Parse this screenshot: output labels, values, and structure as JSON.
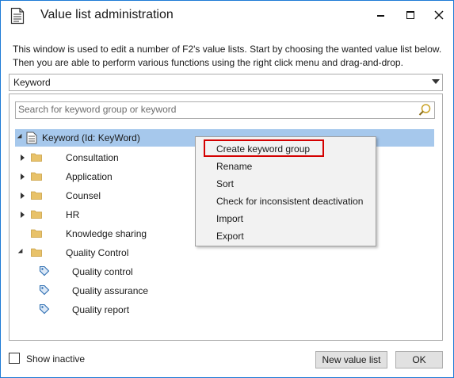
{
  "window": {
    "title": "Value list administration",
    "icons": {
      "app": "document-list-icon",
      "minimize": "minimize-icon",
      "maximize": "maximize-icon",
      "close": "close-icon"
    }
  },
  "description": {
    "line1": "This window is used to edit a number of F2's value lists. Start by choosing the wanted value list below.",
    "line2": "Then you are able to perform various functions using the right click menu and drag-and-drop."
  },
  "value_list_select": {
    "selected": "Keyword"
  },
  "search": {
    "placeholder": "Search for keyword group or keyword",
    "value": ""
  },
  "tree": {
    "root": {
      "label": "Keyword (Id: KeyWord)",
      "icon": "keyword-list-icon",
      "expanded": true,
      "selected": true
    },
    "groups": [
      {
        "label": "Consultation",
        "expander": "collapsed"
      },
      {
        "label": "Application",
        "expander": "collapsed"
      },
      {
        "label": "Counsel",
        "expander": "collapsed"
      },
      {
        "label": "HR",
        "expander": "collapsed"
      },
      {
        "label": "Knowledge sharing",
        "expander": "none"
      },
      {
        "label": "Quality Control",
        "expander": "expanded"
      }
    ],
    "keywords": [
      {
        "label": "Quality control"
      },
      {
        "label": "Quality assurance"
      },
      {
        "label": "Quality report"
      }
    ]
  },
  "context_menu": {
    "items": [
      {
        "label": "Create keyword group",
        "highlighted": true
      },
      {
        "label": "Rename"
      },
      {
        "label": "Sort"
      },
      {
        "label": "Check for inconsistent deactivation"
      },
      {
        "label": "Import"
      },
      {
        "label": "Export"
      }
    ]
  },
  "footer": {
    "show_inactive_label": "Show inactive",
    "show_inactive_checked": false,
    "new_value_list_label": "New value list",
    "ok_label": "OK"
  },
  "colors": {
    "window_border": "#1e7bd6",
    "selection": "#a6c8ec",
    "folder": "#e8c26a",
    "tag_icon": "#2b6cb0",
    "highlight_box": "#d40000",
    "menu_background": "#f2f2f2"
  }
}
